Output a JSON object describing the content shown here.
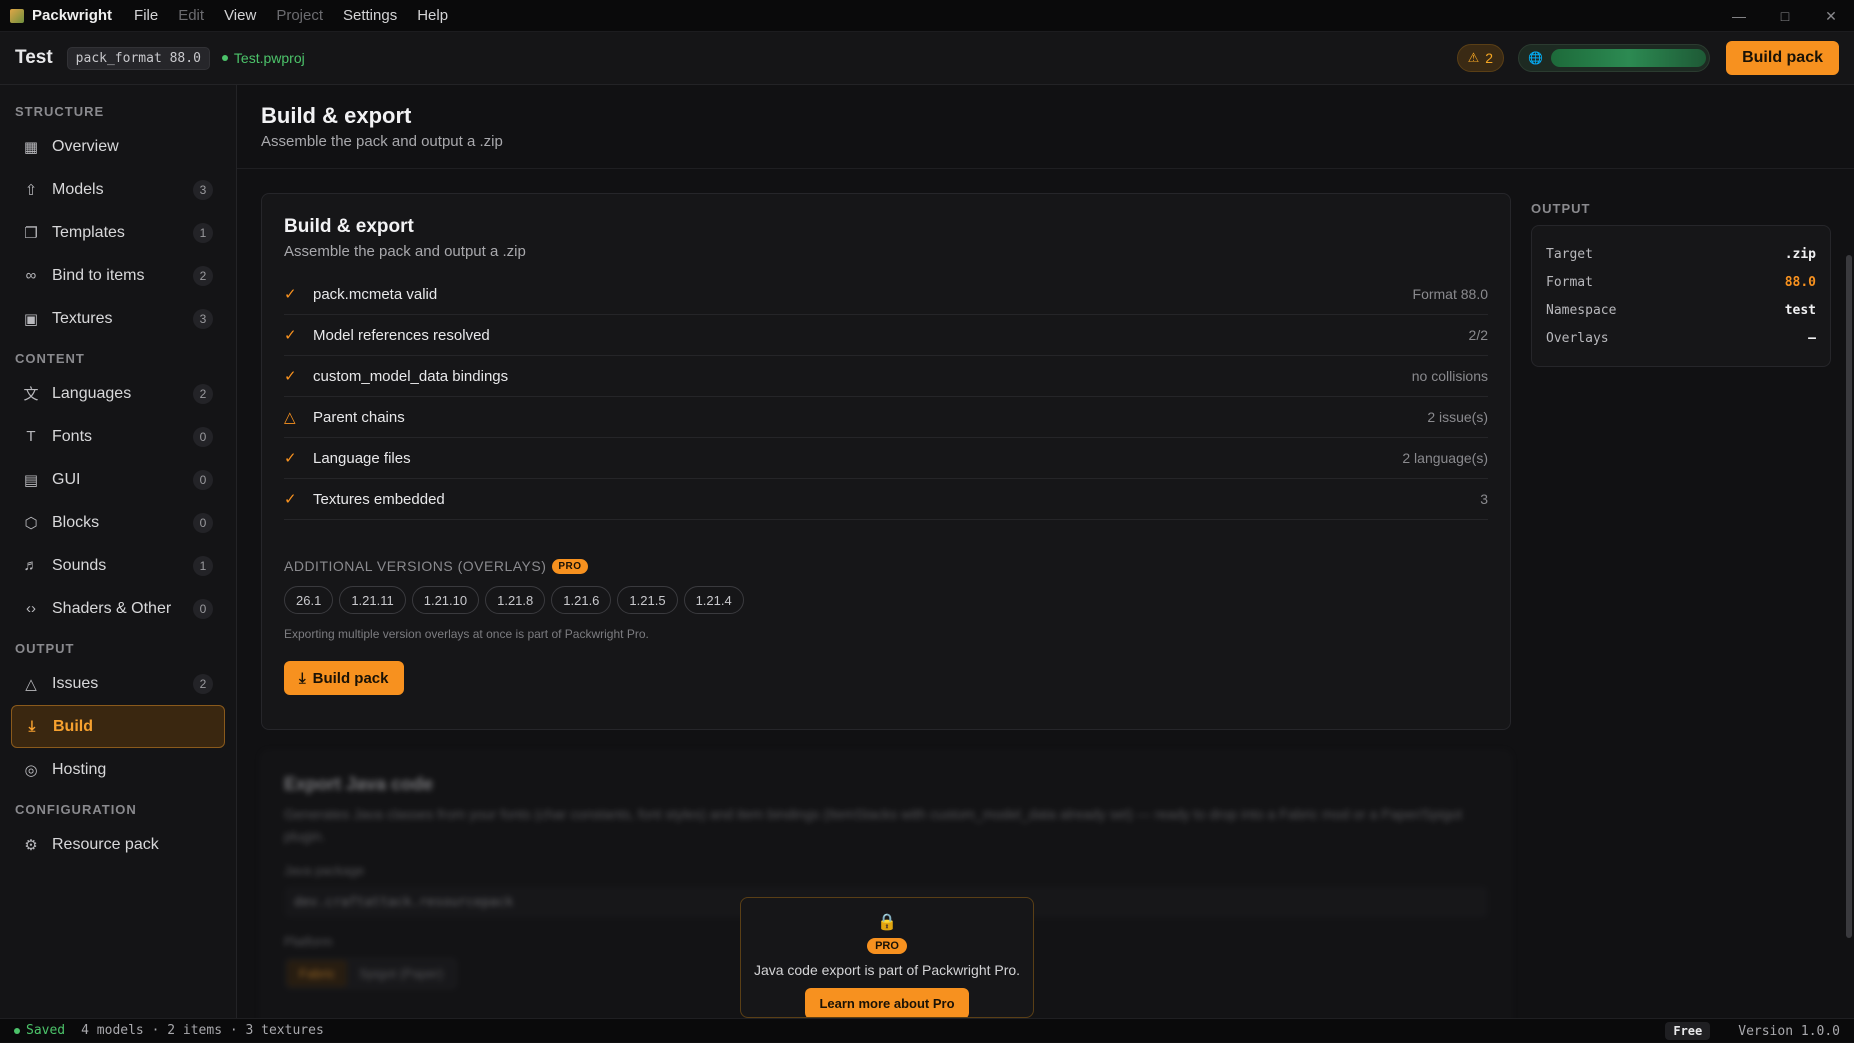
{
  "app": {
    "name": "Packwright",
    "menu": [
      "File",
      "Edit",
      "View",
      "Project",
      "Settings",
      "Help"
    ]
  },
  "header": {
    "project_title": "Test",
    "format_chip": "pack_format 88.0",
    "file_name": "Test.pwproj",
    "warning_count": "2",
    "build_label": "Build pack"
  },
  "sidebar": {
    "sections": {
      "structure": "STRUCTURE",
      "content": "CONTENT",
      "output": "OUTPUT",
      "configuration": "CONFIGURATION"
    },
    "items": {
      "overview": {
        "label": "Overview"
      },
      "models": {
        "label": "Models",
        "count": "3"
      },
      "templates": {
        "label": "Templates",
        "count": "1"
      },
      "bind": {
        "label": "Bind to items",
        "count": "2"
      },
      "textures": {
        "label": "Textures",
        "count": "3"
      },
      "languages": {
        "label": "Languages",
        "count": "2"
      },
      "fonts": {
        "label": "Fonts",
        "count": "0"
      },
      "gui": {
        "label": "GUI",
        "count": "0"
      },
      "blocks": {
        "label": "Blocks",
        "count": "0"
      },
      "sounds": {
        "label": "Sounds",
        "count": "1"
      },
      "shaders": {
        "label": "Shaders & Other",
        "count": "0"
      },
      "issues": {
        "label": "Issues",
        "count": "2"
      },
      "build": {
        "label": "Build"
      },
      "hosting": {
        "label": "Hosting"
      },
      "resource_pack": {
        "label": "Resource pack"
      }
    }
  },
  "page": {
    "title": "Build & export",
    "subtitle": "Assemble the pack and output a .zip"
  },
  "build_card": {
    "title": "Build & export",
    "subtitle": "Assemble the pack and output a .zip",
    "checks": [
      {
        "label": "pack.mcmeta valid",
        "meta": "Format 88.0",
        "status": "ok"
      },
      {
        "label": "Model references resolved",
        "meta": "2/2",
        "status": "ok"
      },
      {
        "label": "custom_model_data bindings",
        "meta": "no collisions",
        "status": "ok"
      },
      {
        "label": "Parent chains",
        "meta": "2 issue(s)",
        "status": "warn"
      },
      {
        "label": "Language files",
        "meta": "2 language(s)",
        "status": "ok"
      },
      {
        "label": "Textures embedded",
        "meta": "3",
        "status": "ok"
      }
    ],
    "overlays_label": "ADDITIONAL VERSIONS (OVERLAYS)",
    "pro_badge": "PRO",
    "versions": [
      "26.1",
      "1.21.11",
      "1.21.10",
      "1.21.8",
      "1.21.6",
      "1.21.5",
      "1.21.4"
    ],
    "overlay_note": "Exporting multiple version overlays at once is part of Packwright Pro.",
    "build_label": "Build pack"
  },
  "java_card": {
    "title": "Export Java code",
    "description": "Generates Java classes from your fonts (char constants, font styles) and item bindings (ItemStacks with custom_model_data already set) — ready to drop into a Fabric mod or a Paper/Spigot plugin.",
    "package_label": "Java package",
    "package_value": "dev.craftattack.resourcepack",
    "platform_label": "Platform",
    "platform_options": [
      "Fabric",
      "Spigot (Paper)"
    ]
  },
  "pro_popup": {
    "badge": "PRO",
    "text": "Java code export is part of Packwright Pro.",
    "button": "Learn more about Pro"
  },
  "output": {
    "label": "OUTPUT",
    "rows": [
      {
        "key": "Target",
        "value": ".zip"
      },
      {
        "key": "Format",
        "value": "88.0"
      },
      {
        "key": "Namespace",
        "value": "test"
      },
      {
        "key": "Overlays",
        "value": "—"
      }
    ]
  },
  "statusbar": {
    "saved": "Saved",
    "summary": "4 models · 2 items · 3 textures",
    "plan": "Free",
    "version": "Version 1.0.0"
  },
  "colors": {
    "accent": "#f7911f",
    "success": "#4cc36a",
    "warning": "#f5a623",
    "background": "#111113"
  }
}
